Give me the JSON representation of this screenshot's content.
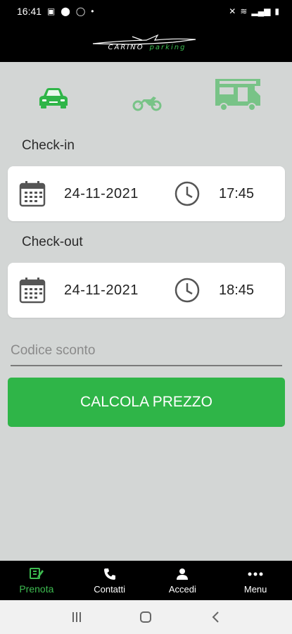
{
  "status": {
    "time": "16:41"
  },
  "header": {
    "logo_brand": "CARINO",
    "logo_sub": "parking"
  },
  "vehicles": [
    {
      "name": "car",
      "selected": true
    },
    {
      "name": "moto",
      "selected": false
    },
    {
      "name": "camper",
      "selected": false
    }
  ],
  "checkin": {
    "label": "Check-in",
    "date": "24-11-2021",
    "time": "17:45"
  },
  "checkout": {
    "label": "Check-out",
    "date": "24-11-2021",
    "time": "18:45"
  },
  "discount": {
    "placeholder": "Codice sconto",
    "value": ""
  },
  "calc_button": "CALCOLA PREZZO",
  "nav": [
    {
      "label": "Prenota",
      "icon": "edit-icon",
      "active": true
    },
    {
      "label": "Contatti",
      "icon": "phone-icon",
      "active": false
    },
    {
      "label": "Accedi",
      "icon": "user-icon",
      "active": false
    },
    {
      "label": "Menu",
      "icon": "more-icon",
      "active": false
    }
  ],
  "colors": {
    "accent": "#2fb548",
    "background": "#d3d6d5",
    "bar": "#000000"
  }
}
